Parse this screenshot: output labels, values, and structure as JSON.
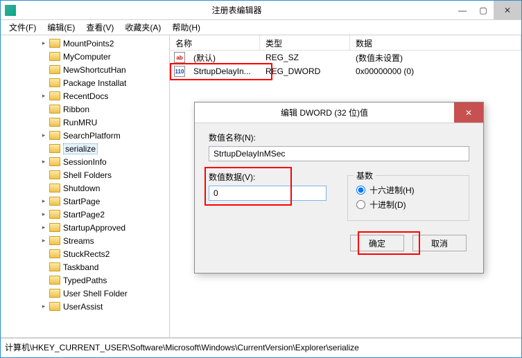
{
  "window": {
    "title": "注册表编辑器",
    "min": "—",
    "max": "▢",
    "close": "✕"
  },
  "menu": [
    {
      "label": "文件(F)"
    },
    {
      "label": "编辑(E)"
    },
    {
      "label": "查看(V)"
    },
    {
      "label": "收藏夹(A)"
    },
    {
      "label": "帮助(H)"
    }
  ],
  "tree": [
    {
      "label": "MountPoints2",
      "exp": "▸"
    },
    {
      "label": "MyComputer",
      "exp": ""
    },
    {
      "label": "NewShortcutHan",
      "exp": ""
    },
    {
      "label": "Package Installat",
      "exp": ""
    },
    {
      "label": "RecentDocs",
      "exp": "▸"
    },
    {
      "label": "Ribbon",
      "exp": ""
    },
    {
      "label": "RunMRU",
      "exp": ""
    },
    {
      "label": "SearchPlatform",
      "exp": "▸"
    },
    {
      "label": "serialize",
      "exp": "",
      "selected": true
    },
    {
      "label": "SessionInfo",
      "exp": "▸"
    },
    {
      "label": "Shell Folders",
      "exp": ""
    },
    {
      "label": "Shutdown",
      "exp": ""
    },
    {
      "label": "StartPage",
      "exp": "▸"
    },
    {
      "label": "StartPage2",
      "exp": "▸"
    },
    {
      "label": "StartupApproved",
      "exp": "▸"
    },
    {
      "label": "Streams",
      "exp": "▸"
    },
    {
      "label": "StuckRects2",
      "exp": ""
    },
    {
      "label": "Taskband",
      "exp": ""
    },
    {
      "label": "TypedPaths",
      "exp": ""
    },
    {
      "label": "User Shell Folder",
      "exp": ""
    },
    {
      "label": "UserAssist",
      "exp": "▸"
    }
  ],
  "list": {
    "cols": {
      "name": "名称",
      "type": "类型",
      "data": "数据"
    },
    "rows": [
      {
        "icon": "ab",
        "name": "(默认)",
        "type": "REG_SZ",
        "data": "(数值未设置)"
      },
      {
        "icon": "110",
        "name": "StrtupDelayIn...",
        "type": "REG_DWORD",
        "data": "0x00000000 (0)"
      }
    ]
  },
  "dialog": {
    "title": "编辑 DWORD (32 位)值",
    "close": "✕",
    "name_label": "数值名称(N):",
    "name_value": "StrtupDelayInMSec",
    "val_label": "数值数据(V):",
    "val_value": "0",
    "base_label": "基数",
    "radio_hex": "十六进制(H)",
    "radio_dec": "十进制(D)",
    "ok": "确定",
    "cancel": "取消"
  },
  "status": "计算机\\HKEY_CURRENT_USER\\Software\\Microsoft\\Windows\\CurrentVersion\\Explorer\\serialize"
}
